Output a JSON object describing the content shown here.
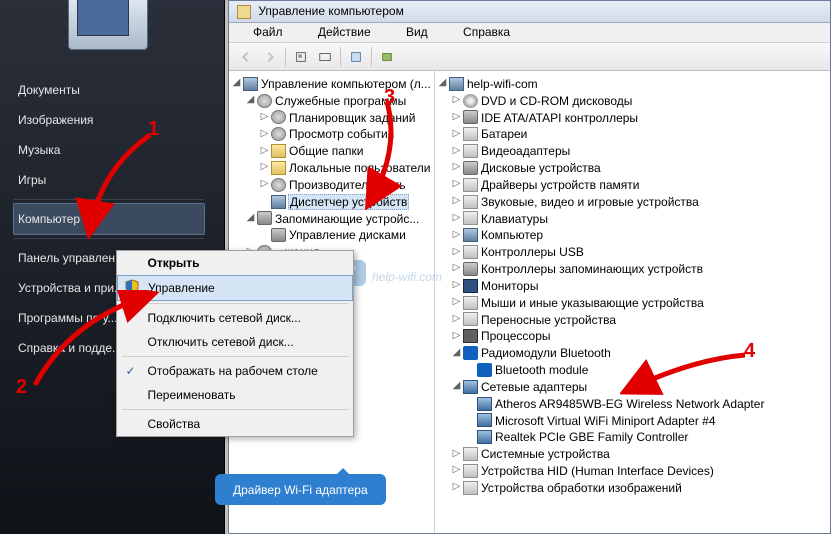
{
  "start_menu": {
    "items": [
      {
        "label": "Документы"
      },
      {
        "label": "Изображения"
      },
      {
        "label": "Музыка"
      },
      {
        "label": "Игры"
      },
      {
        "label": "Компьютер",
        "selected": true
      },
      {
        "label": "Панель управлен..."
      },
      {
        "label": "Устройства и при..."
      },
      {
        "label": "Программы по у..."
      },
      {
        "label": "Справка и подде..."
      }
    ]
  },
  "context_menu": {
    "title": "Открыть",
    "items": [
      {
        "label": "Управление",
        "highlight": true,
        "shield": true
      },
      {
        "sep": true
      },
      {
        "label": "Подключить сетевой диск..."
      },
      {
        "label": "Отключить сетевой диск..."
      },
      {
        "sep": true
      },
      {
        "label": "Отображать на рабочем столе",
        "check": true
      },
      {
        "label": "Переименовать"
      },
      {
        "sep": true
      },
      {
        "label": "Свойства"
      }
    ]
  },
  "window": {
    "title": "Управление компьютером",
    "menu": [
      "Файл",
      "Действие",
      "Вид",
      "Справка"
    ]
  },
  "tree_left": [
    {
      "ind": 0,
      "tog": "exp",
      "icon": "i-comp",
      "label": "Управление компьютером (л..."
    },
    {
      "ind": 1,
      "tog": "exp",
      "icon": "i-gear",
      "label": "Служебные программы"
    },
    {
      "ind": 2,
      "tog": "col",
      "icon": "i-gear",
      "label": "Планировщик заданий"
    },
    {
      "ind": 2,
      "tog": "col",
      "icon": "i-gear",
      "label": "Просмотр событий"
    },
    {
      "ind": 2,
      "tog": "col",
      "icon": "i-fold",
      "label": "Общие папки"
    },
    {
      "ind": 2,
      "tog": "col",
      "icon": "i-fold",
      "label": "Локальные пользователи"
    },
    {
      "ind": 2,
      "tog": "col",
      "icon": "i-gear",
      "label": "Производительность"
    },
    {
      "ind": 2,
      "tog": "",
      "icon": "i-comp",
      "label": "Диспетчер устройств",
      "sel": true
    },
    {
      "ind": 1,
      "tog": "exp",
      "icon": "i-disk",
      "label": "Запоминающие устройс..."
    },
    {
      "ind": 2,
      "tog": "",
      "icon": "i-disk",
      "label": "Управление дисками"
    },
    {
      "ind": 1,
      "tog": "col",
      "icon": "i-gear",
      "label": "...жения"
    }
  ],
  "tree_right": [
    {
      "ind": 0,
      "tog": "exp",
      "icon": "i-comp",
      "label": "help-wifi-com"
    },
    {
      "ind": 1,
      "tog": "col",
      "icon": "i-cd",
      "label": "DVD и CD-ROM дисководы"
    },
    {
      "ind": 1,
      "tog": "col",
      "icon": "i-disk",
      "label": "IDE ATA/ATAPI контроллеры"
    },
    {
      "ind": 1,
      "tog": "col",
      "icon": "i-dev",
      "label": "Батареи"
    },
    {
      "ind": 1,
      "tog": "col",
      "icon": "i-dev",
      "label": "Видеоадаптеры"
    },
    {
      "ind": 1,
      "tog": "col",
      "icon": "i-disk",
      "label": "Дисковые устройства"
    },
    {
      "ind": 1,
      "tog": "col",
      "icon": "i-dev",
      "label": "Драйверы устройств памяти"
    },
    {
      "ind": 1,
      "tog": "col",
      "icon": "i-dev",
      "label": "Звуковые, видео и игровые устройства"
    },
    {
      "ind": 1,
      "tog": "col",
      "icon": "i-dev",
      "label": "Клавиатуры"
    },
    {
      "ind": 1,
      "tog": "col",
      "icon": "i-comp",
      "label": "Компьютер"
    },
    {
      "ind": 1,
      "tog": "col",
      "icon": "i-dev",
      "label": "Контроллеры USB"
    },
    {
      "ind": 1,
      "tog": "col",
      "icon": "i-disk",
      "label": "Контроллеры запоминающих устройств"
    },
    {
      "ind": 1,
      "tog": "col",
      "icon": "i-mon",
      "label": "Мониторы"
    },
    {
      "ind": 1,
      "tog": "col",
      "icon": "i-dev",
      "label": "Мыши и иные указывающие устройства"
    },
    {
      "ind": 1,
      "tog": "col",
      "icon": "i-dev",
      "label": "Переносные устройства"
    },
    {
      "ind": 1,
      "tog": "col",
      "icon": "i-cpu",
      "label": "Процессоры"
    },
    {
      "ind": 1,
      "tog": "exp",
      "icon": "i-bt",
      "label": "Радиомодули Bluetooth"
    },
    {
      "ind": 2,
      "tog": "",
      "icon": "i-bt",
      "label": "Bluetooth module"
    },
    {
      "ind": 1,
      "tog": "exp",
      "icon": "i-net",
      "label": "Сетевые адаптеры"
    },
    {
      "ind": 2,
      "tog": "",
      "icon": "i-net",
      "label": "Atheros AR9485WB-EG Wireless Network Adapter"
    },
    {
      "ind": 2,
      "tog": "",
      "icon": "i-net",
      "label": "Microsoft Virtual WiFi Miniport Adapter #4"
    },
    {
      "ind": 2,
      "tog": "",
      "icon": "i-net",
      "label": "Realtek PCIe GBE Family Controller"
    },
    {
      "ind": 1,
      "tog": "col",
      "icon": "i-dev",
      "label": "Системные устройства"
    },
    {
      "ind": 1,
      "tog": "col",
      "icon": "i-dev",
      "label": "Устройства HID (Human Interface Devices)"
    },
    {
      "ind": 1,
      "tog": "col",
      "icon": "i-dev",
      "label": "Устройства обработки изображений"
    }
  ],
  "annotations": {
    "n1": "1",
    "n2": "2",
    "n3": "3",
    "n4": "4",
    "callout": "Драйвер Wi-Fi адаптера",
    "watermark": "help-wifi.com"
  }
}
